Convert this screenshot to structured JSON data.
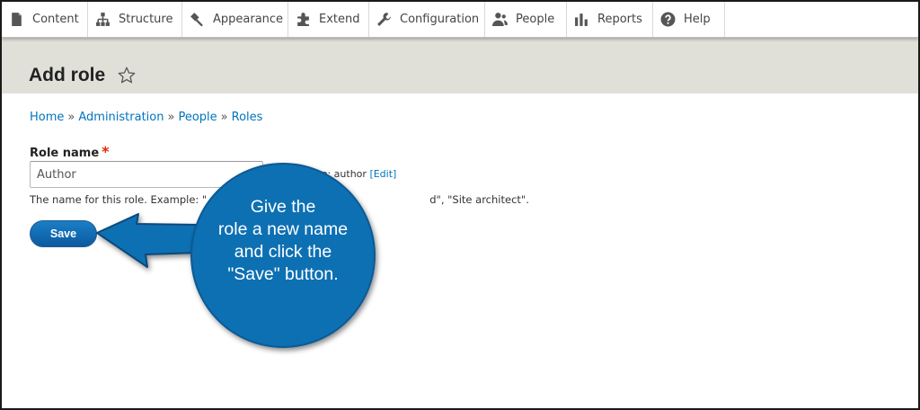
{
  "toolbar": {
    "items": [
      {
        "label": "Content",
        "icon": "content-icon"
      },
      {
        "label": "Structure",
        "icon": "structure-icon"
      },
      {
        "label": "Appearance",
        "icon": "appearance-icon"
      },
      {
        "label": "Extend",
        "icon": "extend-icon"
      },
      {
        "label": "Configuration",
        "icon": "configuration-icon"
      },
      {
        "label": "People",
        "icon": "people-icon"
      },
      {
        "label": "Reports",
        "icon": "reports-icon"
      },
      {
        "label": "Help",
        "icon": "help-icon"
      }
    ]
  },
  "page": {
    "title": "Add role",
    "star_icon": "star-outline-icon"
  },
  "breadcrumb": {
    "items": [
      "Home",
      "Administration",
      "People",
      "Roles"
    ],
    "separator": "»"
  },
  "form": {
    "role_name_label": "Role name",
    "required_marker": "*",
    "role_name_value": "Author",
    "machine_name_prefix": "me: author",
    "machine_name_edit": "[Edit]",
    "description_start": "The name for this role. Example: \"",
    "description_end": "d\", \"Site architect\".",
    "save_label": "Save"
  },
  "annotation": {
    "lines": [
      "Give the",
      "role a new name",
      "and click the",
      "\"Save\" button."
    ],
    "color": "#0b6fb3"
  },
  "colors": {
    "link": "#0074bd",
    "header_band": "#e0e0d8",
    "button": "#0c6ab2",
    "required": "#e32700"
  }
}
